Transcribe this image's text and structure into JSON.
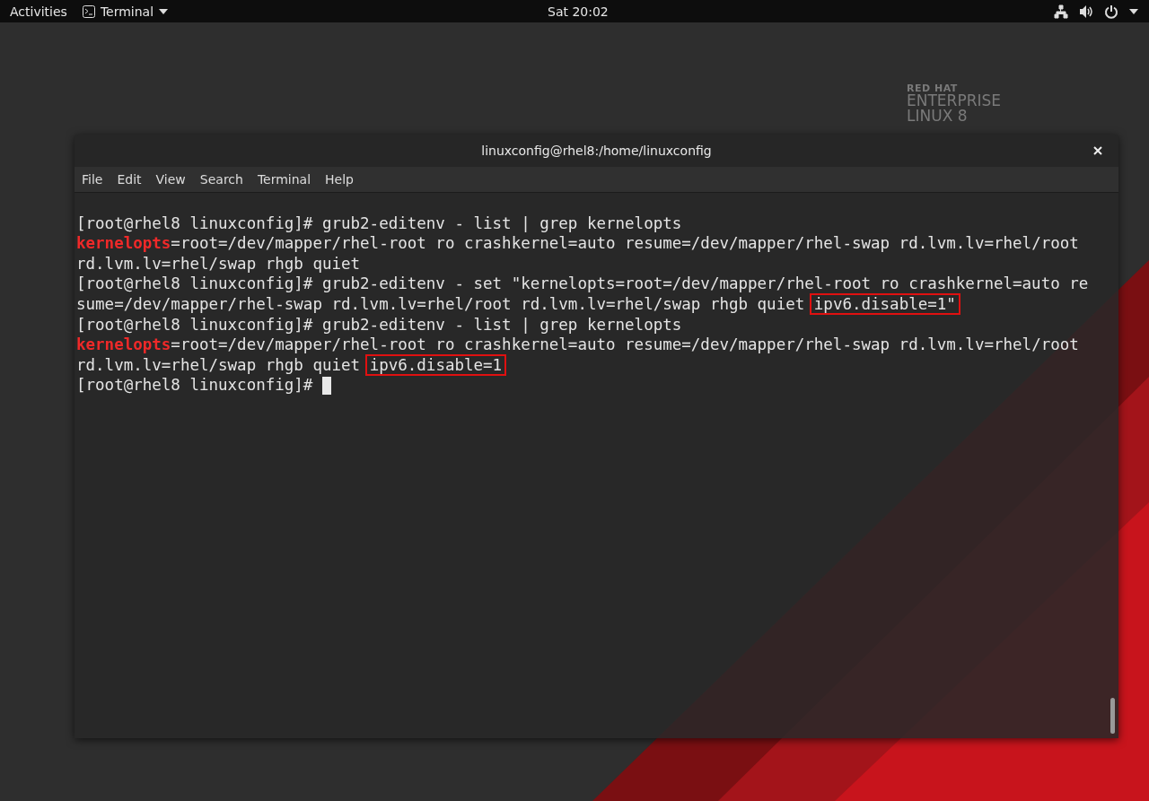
{
  "top_bar": {
    "activities": "Activities",
    "app_menu": "Terminal",
    "clock": "Sat 20:02"
  },
  "desktop_logo": {
    "line_1": "RED HAT",
    "line_2": "ENTERPRISE",
    "line_3": "LINUX 8"
  },
  "window": {
    "title": "linuxconfig@rhel8:/home/linuxconfig",
    "menu": [
      "File",
      "Edit",
      "View",
      "Search",
      "Terminal",
      "Help"
    ]
  },
  "terminal": {
    "lines": [
      [
        {
          "kind": "plain",
          "text": "[root@rhel8 linuxconfig]# grub2-editenv - list | grep kernelopts"
        }
      ],
      [
        {
          "kind": "keyword",
          "text": "kernelopts"
        },
        {
          "kind": "plain",
          "text": "=root=/dev/mapper/rhel-root ro crashkernel=auto resume=/dev/mapper/rhel-swap rd.lvm.lv=rhel/root"
        }
      ],
      [
        {
          "kind": "plain",
          "text": "rd.lvm.lv=rhel/swap rhgb quiet"
        }
      ],
      [
        {
          "kind": "plain",
          "text": "[root@rhel8 linuxconfig]# grub2-editenv - set \"kernelopts=root=/dev/mapper/rhel-root ro crashkernel=auto re"
        }
      ],
      [
        {
          "kind": "plain",
          "text": "sume=/dev/mapper/rhel-swap rd.lvm.lv=rhel/root rd.lvm.lv=rhel/swap rhgb quiet "
        },
        {
          "kind": "highlight",
          "text": "ipv6.disable=1\""
        }
      ],
      [
        {
          "kind": "plain",
          "text": "[root@rhel8 linuxconfig]# grub2-editenv - list | grep kernelopts"
        }
      ],
      [
        {
          "kind": "keyword",
          "text": "kernelopts"
        },
        {
          "kind": "plain",
          "text": "=root=/dev/mapper/rhel-root ro crashkernel=auto resume=/dev/mapper/rhel-swap rd.lvm.lv=rhel/root"
        }
      ],
      [
        {
          "kind": "plain",
          "text": "rd.lvm.lv=rhel/swap rhgb quiet "
        },
        {
          "kind": "highlight",
          "text": "ipv6.disable=1"
        }
      ],
      [
        {
          "kind": "plain",
          "text": "[root@rhel8 linuxconfig]# "
        },
        {
          "kind": "cursor"
        }
      ]
    ]
  }
}
